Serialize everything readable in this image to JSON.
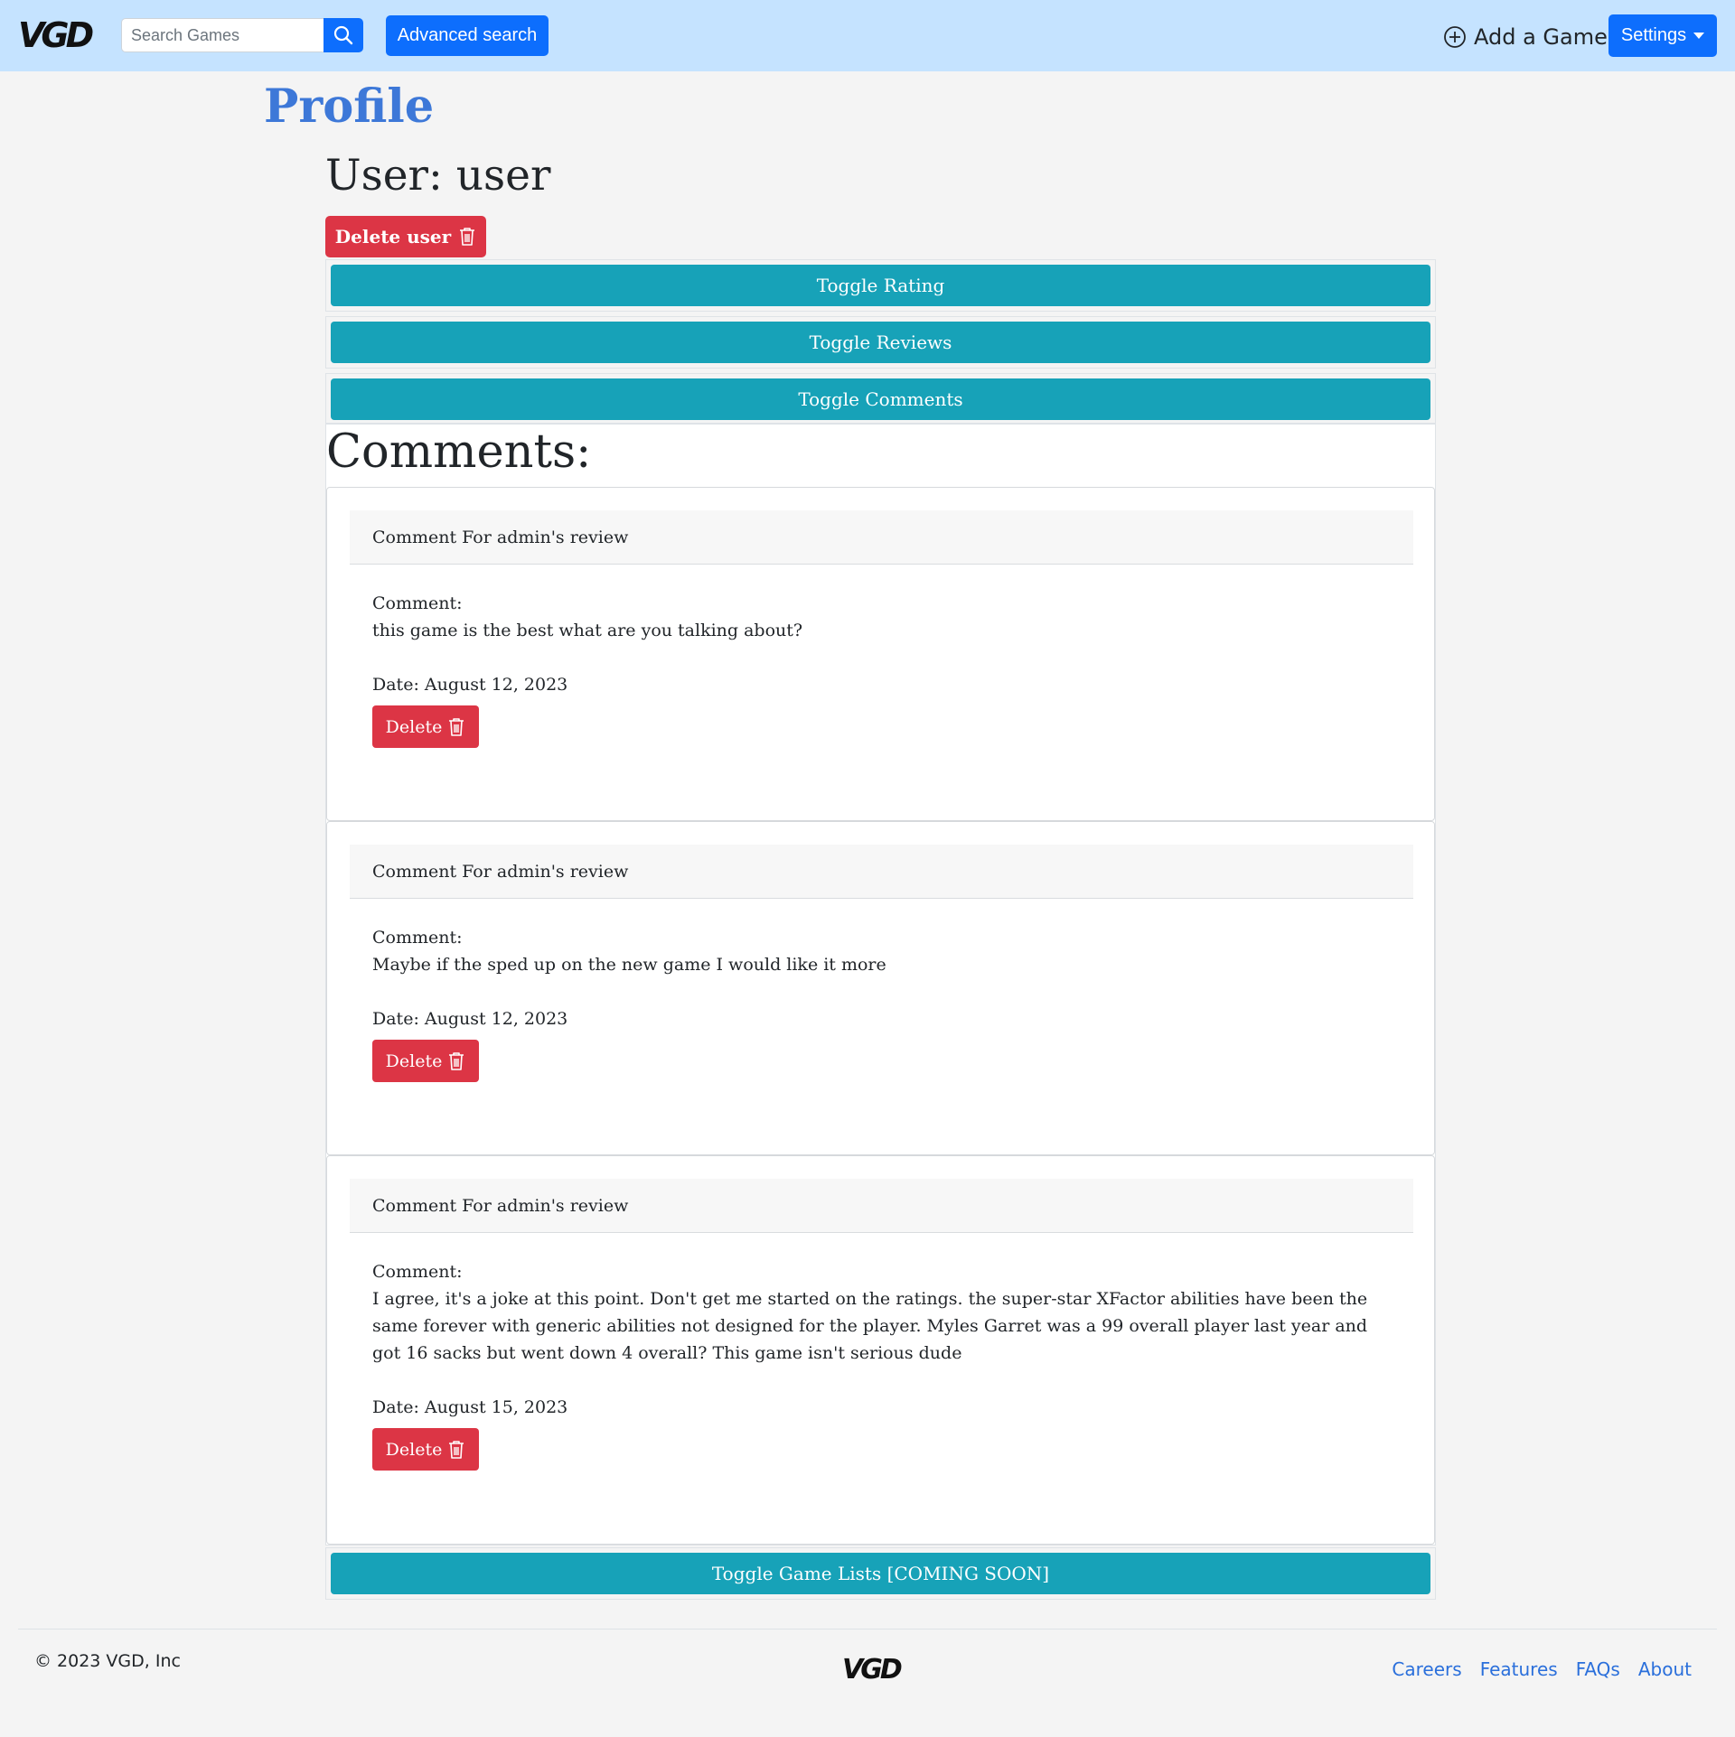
{
  "navbar": {
    "logo_text": "VGD",
    "search_placeholder": "Search Games",
    "advanced_search_label": "Advanced search",
    "add_game_label": "Add a Game",
    "settings_label": "Settings"
  },
  "page": {
    "title": "Profile",
    "user_heading": "User: user",
    "delete_user_label": "Delete user"
  },
  "accordion": {
    "toggle_rating": "Toggle Rating",
    "toggle_reviews": "Toggle Reviews",
    "toggle_comments": "Toggle Comments",
    "toggle_game_lists": "Toggle Game Lists [COMING SOON]"
  },
  "comments": {
    "heading": "Comments:",
    "items": [
      {
        "header": "Comment For admin's review",
        "label": "Comment:",
        "text": "this game is the best what are you talking about?",
        "date": "Date: August 12, 2023",
        "delete_label": "Delete"
      },
      {
        "header": "Comment For admin's review",
        "label": "Comment:",
        "text": "Maybe if the sped up on the new game I would like it more",
        "date": "Date: August 12, 2023",
        "delete_label": "Delete"
      },
      {
        "header": "Comment For admin's review",
        "label": "Comment:",
        "text": "I agree, it's a joke at this point. Don't get me started on the ratings. the super-star XFactor abilities have been the same forever with generic abilities not designed for the player. Myles Garret was a 99 overall player last year and got 16 sacks but went down 4 overall? This game isn't serious dude",
        "date": "Date: August 15, 2023",
        "delete_label": "Delete"
      }
    ]
  },
  "footer": {
    "copyright": "© 2023 VGD, Inc",
    "links": [
      "Careers",
      "Features",
      "FAQs",
      "About"
    ]
  },
  "colors": {
    "navbar_bg": "#c5e3ff",
    "primary": "#0d6efd",
    "danger": "#dc3545",
    "info": "#17a2b8",
    "title_blue": "#3d78d8",
    "link_blue": "#2a6fdb"
  },
  "icons": [
    "logo",
    "search-icon",
    "plus-circle-icon",
    "chevron-down-icon",
    "trash-icon"
  ]
}
